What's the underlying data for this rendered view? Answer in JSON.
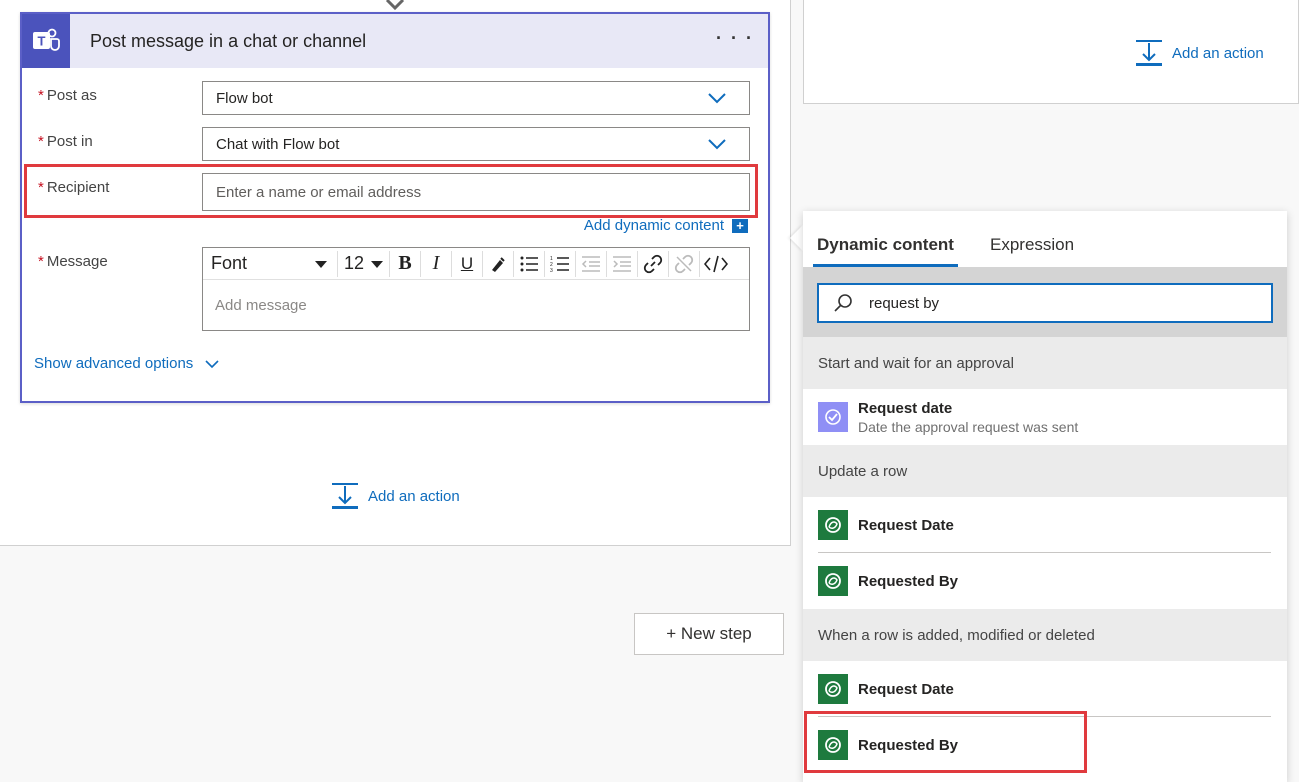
{
  "card": {
    "title": "Post message in a chat or channel",
    "more": "· · ·",
    "fields": {
      "post_as": {
        "label": "Post as",
        "value": "Flow bot"
      },
      "post_in": {
        "label": "Post in",
        "value": "Chat with Flow bot"
      },
      "recipient": {
        "label": "Recipient",
        "placeholder": "Enter a name or email address"
      },
      "message": {
        "label": "Message",
        "placeholder": "Add message"
      }
    },
    "required_mark": "*",
    "add_dynamic_content": "Add dynamic content",
    "toolbar": {
      "font": "Font",
      "size": "12"
    },
    "show_advanced": "Show advanced options"
  },
  "add_action_label": "Add an action",
  "new_step_label": "+ New step",
  "flyout": {
    "tabs": [
      "Dynamic content",
      "Expression"
    ],
    "search_value": "request by",
    "groups": [
      {
        "header": "Start and wait for an approval",
        "items": [
          {
            "title": "Request date",
            "desc": "Date the approval request was sent",
            "icon": "approval-icon"
          }
        ]
      },
      {
        "header": "Update a row",
        "items": [
          {
            "title": "Request Date",
            "icon": "dataverse-icon"
          },
          {
            "title": "Requested By",
            "icon": "dataverse-icon"
          }
        ]
      },
      {
        "header": "When a row is added, modified or deleted",
        "items": [
          {
            "title": "Request Date",
            "icon": "dataverse-icon"
          },
          {
            "title": "Requested By",
            "icon": "dataverse-icon"
          }
        ]
      }
    ]
  },
  "colors": {
    "accent": "#0f6cbd",
    "teams": "#4b53bc",
    "highlight": "#e03a3e",
    "dataverse": "#1e7a3e"
  }
}
